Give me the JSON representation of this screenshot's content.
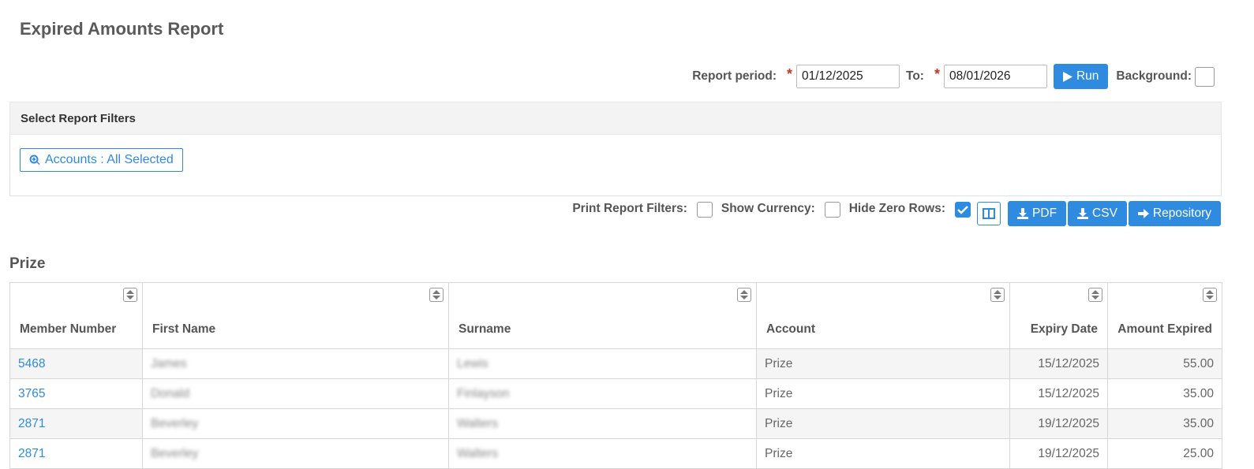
{
  "page": {
    "title": "Expired Amounts Report"
  },
  "period": {
    "label": "Report period:",
    "required_mark": "*",
    "from_value": "01/12/2025",
    "to_label": "To:",
    "to_value": "08/01/2026",
    "run_label": "Run",
    "background_label": "Background:",
    "background_checked": false
  },
  "filters": {
    "heading": "Select Report Filters",
    "accounts_button": "Accounts : All Selected"
  },
  "options": {
    "print_filters_label": "Print Report Filters:",
    "print_filters_checked": false,
    "show_currency_label": "Show Currency:",
    "show_currency_checked": false,
    "hide_zero_label": "Hide Zero Rows:",
    "hide_zero_checked": true,
    "pdf_label": "PDF",
    "csv_label": "CSV",
    "repository_label": "Repository"
  },
  "section": {
    "title": "Prize"
  },
  "table": {
    "headers": [
      "Member Number",
      "First Name",
      "Surname",
      "Account",
      "Expiry Date",
      "Amount Expired"
    ],
    "rows": [
      [
        "5468",
        "James",
        "Lewis",
        "Prize",
        "15/12/2025",
        "55.00"
      ],
      [
        "3765",
        "Donald",
        "Finlayson",
        "Prize",
        "15/12/2025",
        "35.00"
      ],
      [
        "2871",
        "Beverley",
        "Walters",
        "Prize",
        "19/12/2025",
        "35.00"
      ],
      [
        "2871",
        "Beverley",
        "Walters",
        "Prize",
        "19/12/2025",
        "25.00"
      ]
    ]
  },
  "colors": {
    "accent": "#2e8be0",
    "required": "#c0392b"
  }
}
